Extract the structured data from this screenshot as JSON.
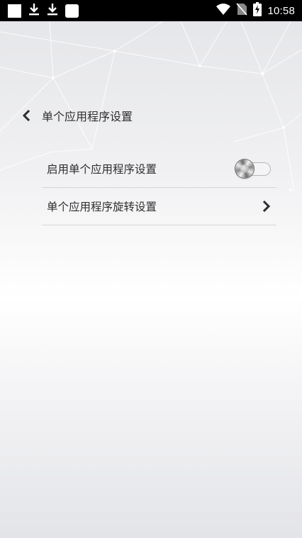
{
  "status_bar": {
    "time": "10:58",
    "left_icons": [
      "notification-square",
      "download-icon",
      "download-icon",
      "notification-square"
    ],
    "right_icons": [
      "wifi-icon",
      "no-sim-icon",
      "battery-charging-icon"
    ]
  },
  "header": {
    "title": "单个应用程序设置",
    "back_icon": "chevron-left-icon"
  },
  "settings": {
    "enable_label": "启用单个应用程序设置",
    "enable_state": "off",
    "rotation_label": "单个应用程序旋转设置",
    "rotation_icon": "chevron-right-icon"
  },
  "colors": {
    "text": "#2d2d2d",
    "divider": "#d6d6d9",
    "status_bar": "#000000"
  }
}
